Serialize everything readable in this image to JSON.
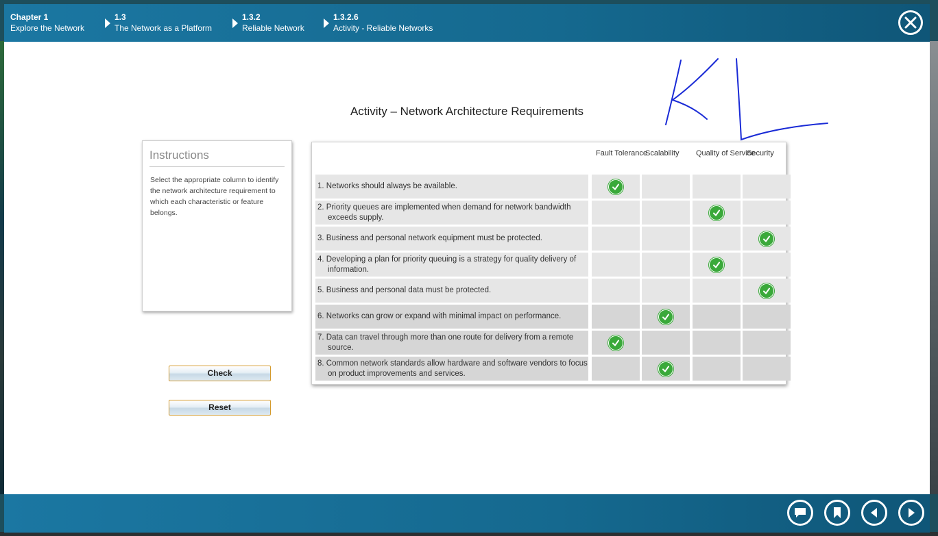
{
  "breadcrumbs": [
    {
      "num": "Chapter 1",
      "label": "Explore the Network"
    },
    {
      "num": "1.3",
      "label": "The Network as a Platform"
    },
    {
      "num": "1.3.2",
      "label": "Reliable Network"
    },
    {
      "num": "1.3.2.6",
      "label": "Activity - Reliable Networks"
    }
  ],
  "activity_title": "Activity – Network Architecture Requirements",
  "instructions": {
    "heading": "Instructions",
    "text": "Select the appropriate column to identify the network architecture requirement to which each characteristic or feature belongs."
  },
  "buttons": {
    "check": "Check",
    "reset": "Reset"
  },
  "columns": [
    "Fault Tolerance",
    "Scalability",
    "Quality of Service",
    "Security"
  ],
  "rows": [
    {
      "text": "1. Networks should always be available.",
      "selected_column": "Fault Tolerance"
    },
    {
      "text": "2. Priority queues are implemented when demand for network bandwidth exceeds supply.",
      "selected_column": "Quality of Service"
    },
    {
      "text": "3. Business and personal network equipment must be protected.",
      "selected_column": "Security"
    },
    {
      "text": "4. Developing a plan for priority queuing is a strategy for quality delivery of information.",
      "selected_column": "Quality of Service"
    },
    {
      "text": "5. Business and personal data must be protected.",
      "selected_column": "Security"
    },
    {
      "text": "6. Networks can grow or expand with minimal impact on performance.",
      "selected_column": "Scalability"
    },
    {
      "text": "7. Data can travel through more than one route for delivery from a remote source.",
      "selected_column": "Fault Tolerance"
    },
    {
      "text": "8. Common network standards allow hardware and software vendors to focus on product improvements and services.",
      "selected_column": "Scalability"
    }
  ],
  "annotation": "KL",
  "colors": {
    "header": "#1b77a2",
    "check": "#3aa93a",
    "button_border": "#d49a2c",
    "annotation_ink": "#1a2bd6"
  },
  "icons": {
    "close": "close-icon",
    "check": "checkmark-icon",
    "footer": [
      "comment-icon",
      "bookmark-icon",
      "previous-icon",
      "next-icon"
    ]
  }
}
